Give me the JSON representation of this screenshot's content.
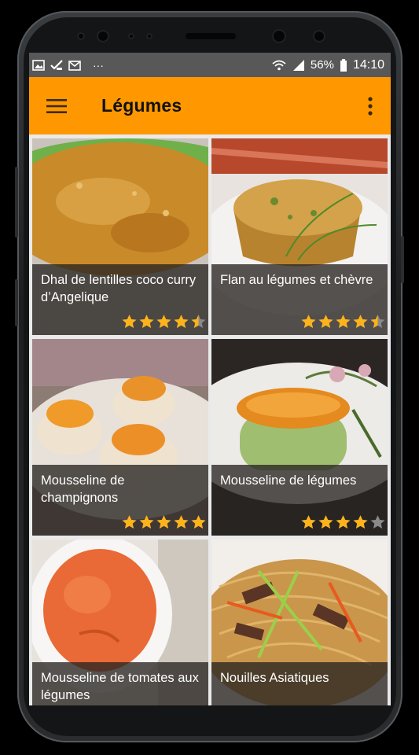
{
  "status_bar": {
    "left_icons": [
      "image-icon",
      "check-icon",
      "mail-icon"
    ],
    "more": "···",
    "battery": "56%",
    "time": "14:10"
  },
  "app_bar": {
    "title": "Légumes",
    "menu_icon": "hamburger-menu-icon",
    "overflow_icon": "more-vert-icon"
  },
  "colors": {
    "accent": "#ff9800",
    "star": "#ffb31a",
    "star_empty": "#8a8a8a",
    "overlay": "#282421"
  },
  "recipes": [
    {
      "name": "Dhal de lentilles coco curry d’Angelique",
      "rating": 4.5
    },
    {
      "name": "Flan au légumes et chèvre",
      "rating": 4.5
    },
    {
      "name": "Mousseline de champignons",
      "rating": 5
    },
    {
      "name": "Mousseline de légumes",
      "rating": 4
    },
    {
      "name": "Mousseline de tomates aux légumes",
      "rating": null
    },
    {
      "name": "Nouilles Asiatiques",
      "rating": null
    }
  ]
}
